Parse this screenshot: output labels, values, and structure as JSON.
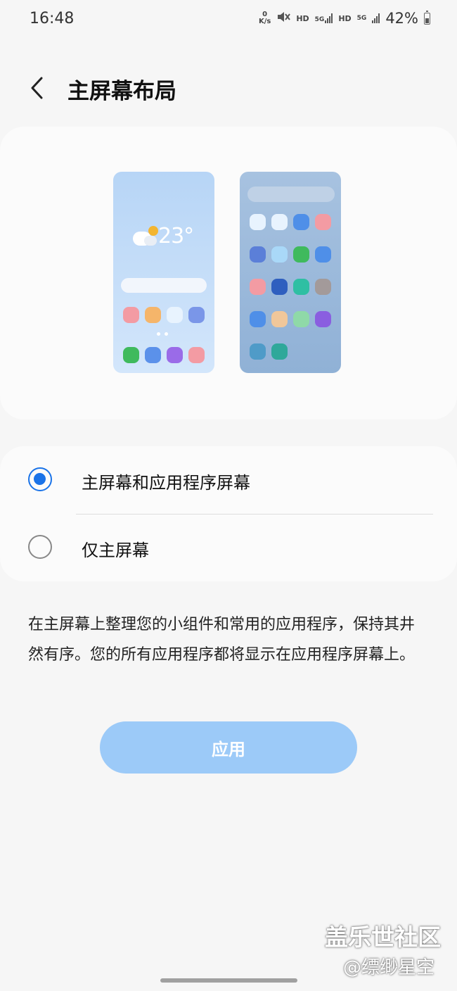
{
  "status_bar": {
    "time": "16:48",
    "net_speed_value": "0",
    "net_speed_unit": "K/s",
    "hd_1": "HD",
    "net_1": "5G",
    "hd_2": "HD",
    "net_2": "5G",
    "battery_text": "42%",
    "battery_level": 0.42
  },
  "header": {
    "title": "主屏幕布局",
    "back_icon": "chevron-left-icon"
  },
  "preview": {
    "weather_temp": "23°",
    "weather_icon": "partly-sunny-icon",
    "phone_a_apps": [
      "#f39ba3",
      "#f5b56a",
      "#e8f3fe",
      "#7a96e8",
      "#3fba5d",
      "#5b91ea",
      "#9a6be8",
      "#f39ba3"
    ],
    "phone_b_apps": [
      "#e8f3fe",
      "#e8f3fe",
      "#4f8fe8",
      "#f39ba3",
      "#5b7fd8",
      "#a9d8f8",
      "#3fba5d",
      "#4f8fe8",
      "#f39ba3",
      "#2f5fbf",
      "#2fbfa3",
      "#a39a9a",
      "#4f8fe8",
      "#f0c79a",
      "#8fd9a8",
      "#8a5ee0",
      "#4f9bc8",
      "#2fa89a"
    ]
  },
  "options": [
    {
      "label": "主屏幕和应用程序屏幕",
      "selected": true
    },
    {
      "label": "仅主屏幕",
      "selected": false
    }
  ],
  "description": "在主屏幕上整理您的小组件和常用的应用程序，保持其井然有序。您的所有应用程序都将显示在应用程序屏幕上。",
  "apply_button": "应用",
  "watermark": {
    "line1": "盖乐世社区",
    "line2": "@缥缈星空"
  },
  "colors": {
    "accent": "#1a73e8",
    "apply_bg": "#9ccaf8",
    "background": "#f6f6f6"
  }
}
